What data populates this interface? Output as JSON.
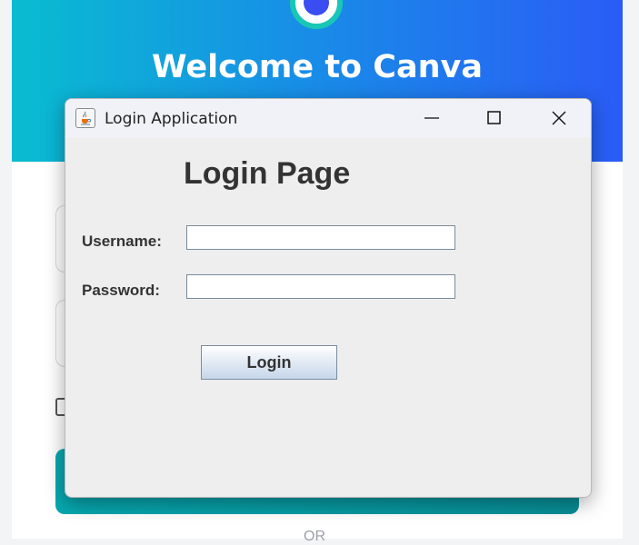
{
  "background_page": {
    "title": "Welcome to Canva",
    "or_text": "OR"
  },
  "window": {
    "title": "Login Application",
    "app_icon": "java-cup-icon",
    "controls": [
      "minimize-icon",
      "maximize-icon",
      "close-icon"
    ]
  },
  "form": {
    "heading": "Login Page",
    "username_label": "Username:",
    "username_value": "",
    "password_label": "Password:",
    "password_value": "",
    "login_label": "Login"
  },
  "colors": {
    "header_gradient_start": "#09bcd0",
    "header_gradient_end": "#2a5cf6",
    "canva_button": "#07a8b0",
    "window_bg": "#eeeeee"
  }
}
